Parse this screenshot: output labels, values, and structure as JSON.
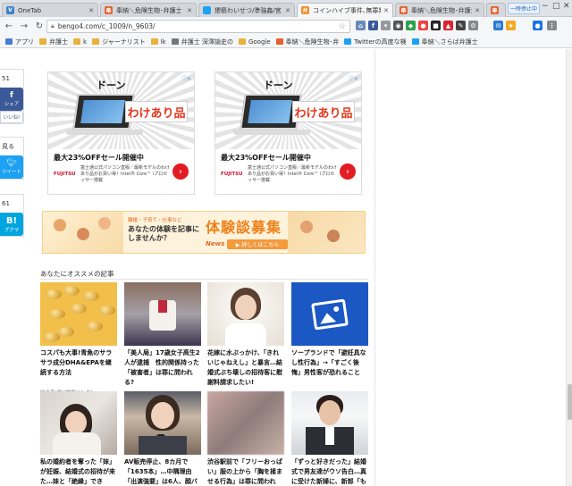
{
  "browser": {
    "tabs": [
      {
        "title": "OneTab",
        "favicon_color": "#3b82c4",
        "favicon": "V",
        "active": false
      },
      {
        "title": "奉納＼危険生物･弁護士",
        "favicon_color": "#e8602c",
        "favicon": "奉",
        "active": false
      },
      {
        "title": "猥褻わいせつ/準強姦/宮",
        "favicon_color": "#1da1f2",
        "favicon": "",
        "active": false
      },
      {
        "title": "コインハイブ事件､無罪判",
        "favicon_color": "#f08a24",
        "favicon": "弁",
        "active": true
      },
      {
        "title": "奉納＼危険生物･弁護士",
        "favicon_color": "#e8602c",
        "favicon": "奉",
        "active": false
      },
      {
        "title": "奉納＼危険生物･弁護士",
        "favicon_color": "#e8602c",
        "favicon": "奉",
        "active": false
      }
    ],
    "user_badge": "一時停止中",
    "url": "bengo4.com/c_1009/n_9603/",
    "bookmarks": [
      {
        "label": "アプリ",
        "color": "#4a7ad6"
      },
      {
        "label": "弁護士",
        "color": "#e8b23a"
      },
      {
        "label": "k",
        "color": "#e8b23a"
      },
      {
        "label": "ジャーナリスト",
        "color": "#e8b23a"
      },
      {
        "label": "lk",
        "color": "#e8b23a"
      },
      {
        "label": "弁護士 深澤諭史の",
        "color": "#777777"
      },
      {
        "label": "Google",
        "color": "#e8b23a"
      },
      {
        "label": "奉納＼危険生物･弁",
        "color": "#e8602c"
      },
      {
        "label": "Twitterの高度な検",
        "color": "#1da1f2"
      },
      {
        "label": "奉納＼さらば弁護士",
        "color": "#1da1f2"
      }
    ]
  },
  "share": {
    "count_top": "51",
    "facebook_label": "シェア",
    "hatena_label": "いいね!",
    "mirumi": "見る",
    "tweet_label": "ツイート",
    "count_mid": "61",
    "hatena_b": "B!",
    "hatena_b_label": "ブクマ"
  },
  "ads": [
    {
      "dooon": "ドーン",
      "badge": "わけあり品",
      "headline": "最大23%OFFセール開催中",
      "brand": "FUJITSU",
      "desc": "富士通公式パソコン直販／最新モデルのわけあり品がお買い得！Intel® Core™ iプロセッサー搭載"
    },
    {
      "dooon": "ドーン",
      "badge": "わけあり品",
      "headline": "最大23%OFFセール開催中",
      "brand": "FUJITSU",
      "desc": "富士通公式パソコン直販／最新モデルのわけあり品がお買い得！Intel® Core™ iプロセッサー搭載"
    }
  ],
  "banner": {
    "sub": "離婚・子育て・仕事など",
    "question": "あなたの体験を記事にしませんか？",
    "title": "体験談募集",
    "brand": "News",
    "button": "▶ 詳しくはこちら"
  },
  "recommend": {
    "heading": "あなたにオススメの記事",
    "cards": [
      {
        "title": "コスパも大事!青魚のサラサラ成分DHA&EPAを継続する方法",
        "meta": "味の素(株)[提供リンク]"
      },
      {
        "title": "「美人局」17歳女子高生2人が逮捕　性的関係持った「被害者」は罪に問われる?",
        "meta": ""
      },
      {
        "title": "花嫁に水ぶっかけ、「きれいじゃねえし」と暴言…結婚式ぶち壊しの招待客に慰謝料請求したい!",
        "meta": ""
      },
      {
        "title": "ソープランドで「避妊具なし性行為」→「すごく後悔」男性客が恐れること",
        "meta": ""
      },
      {
        "title": "私の婚約者を奪った「妹」が妊娠、結婚式の招待が来た…妹と「絶縁」でき",
        "meta": ""
      },
      {
        "title": "AV販売停止、8カ月で「1635本」…中隅理由「出演強要」は6人、顔バレ",
        "meta": ""
      },
      {
        "title": "渋谷駅前で「フリーおっぱい」服の上から「胸を揉ませる行為」は罪に問われ",
        "meta": ""
      },
      {
        "title": "「ずっと好きだった」結婚式で男友達がウソ告白…真に受けた新婦に、新郎「も",
        "meta": ""
      }
    ]
  }
}
